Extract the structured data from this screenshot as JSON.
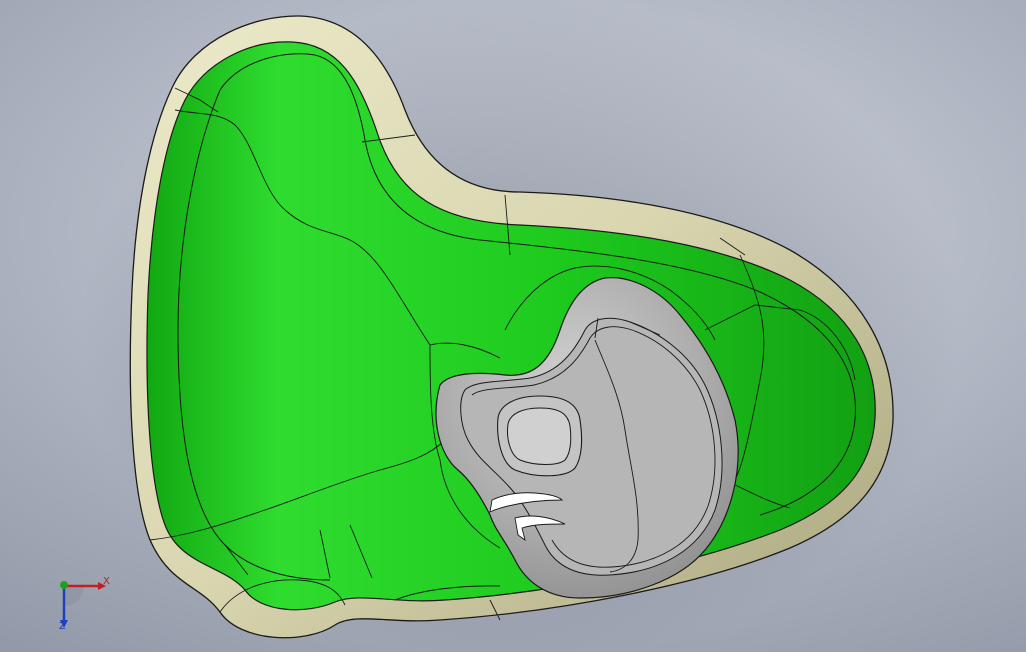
{
  "triad": {
    "x_label": "X",
    "z_label": "Z"
  },
  "colors": {
    "face_green": "#22cc22",
    "face_green_dark": "#0f9a0f",
    "rim_tan": "#d9d6b0",
    "rim_tan_dark": "#a8a47c",
    "boss_grey": "#a9a9a9",
    "boss_grey_light": "#c8c8c8",
    "edge_line": "#1a1a1a",
    "axis_x": "#c02020",
    "axis_y": "#20a020",
    "axis_z": "#2040c0"
  },
  "icons": {
    "view_triad": "view-orientation-triad-icon"
  }
}
